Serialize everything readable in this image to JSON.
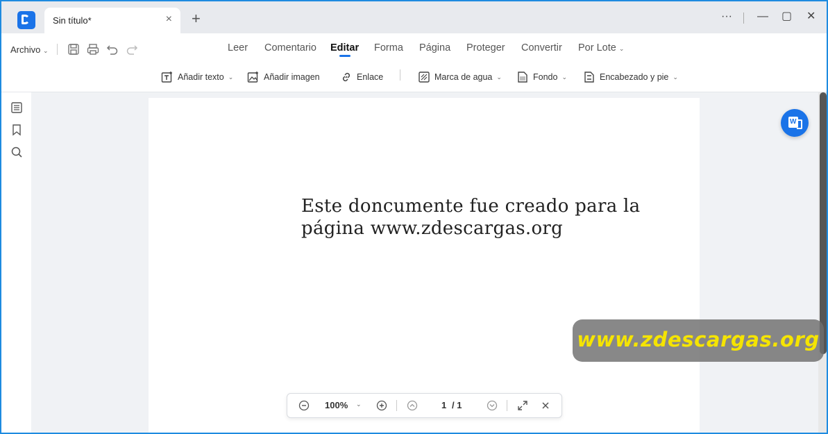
{
  "titlebar": {
    "tab_title": "Sin título*",
    "tab_close": "×",
    "new_tab": "+",
    "more": "···",
    "minimize": "—",
    "maximize": "▢",
    "close": "✕"
  },
  "toolbar": {
    "archivo": "Archivo",
    "menus": [
      "Leer",
      "Comentario",
      "Editar",
      "Forma",
      "Página",
      "Proteger",
      "Convertir",
      "Por Lote"
    ],
    "active_menu": "Editar",
    "sub": {
      "add_text": "Añadir texto",
      "add_image": "Añadir imagen",
      "link": "Enlace",
      "watermark": "Marca de agua",
      "background": "Fondo",
      "header_footer": "Encabezado y pie"
    }
  },
  "document": {
    "text": "Este doncumente fue creado para la página www.zdescargas.org"
  },
  "overlay": {
    "watermark": "www.zdescargas.org",
    "word_button": "W"
  },
  "zoombar": {
    "zoom": "100%",
    "current_page": "1",
    "total_pages": "/ 1"
  },
  "colors": {
    "accent": "#1a73e8",
    "watermark_text": "#f5e400"
  }
}
